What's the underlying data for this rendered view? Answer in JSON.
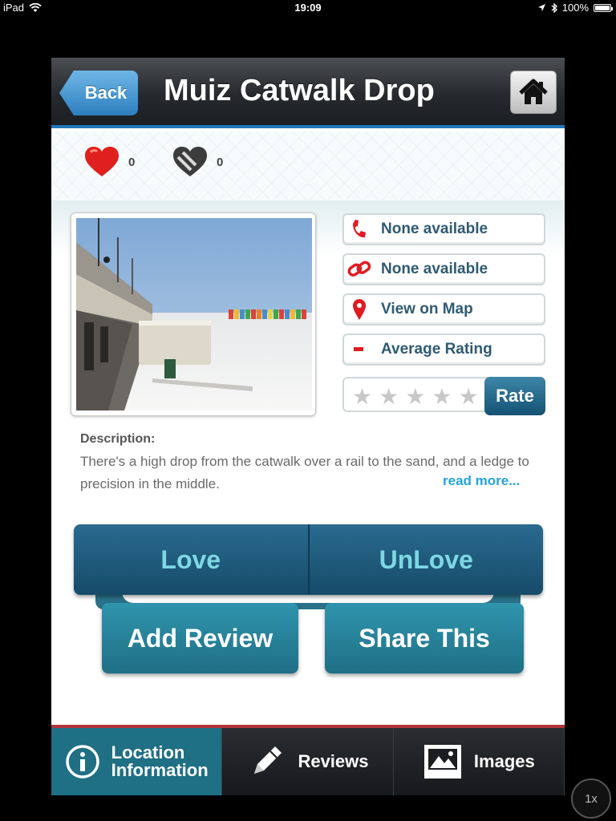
{
  "status_bar": {
    "device": "iPad",
    "time": "19:09",
    "battery": "100%"
  },
  "nav": {
    "back_label": "Back",
    "title": "Muiz Catwalk Drop"
  },
  "counters": {
    "love_count": "0",
    "unlove_count": "0"
  },
  "info_buttons": [
    {
      "label": "None available",
      "icon": "phone-icon"
    },
    {
      "label": "None available",
      "icon": "link-icon"
    },
    {
      "label": "View on Map",
      "icon": "map-pin-icon"
    },
    {
      "label": "Average Rating",
      "icon": "rating-indicator-icon"
    }
  ],
  "rating": {
    "stars_filled": 0,
    "stars_total": 5,
    "rate_label": "Rate"
  },
  "description": {
    "title": "Description:",
    "text": "There's a high drop from the catwalk over a rail to the sand, and a ledge to precision in the middle.",
    "read_more": "read more..."
  },
  "actions": {
    "love": "Love",
    "unlove": "UnLove",
    "add_review": "Add Review",
    "share": "Share This"
  },
  "tabs": [
    {
      "label": "Location Information",
      "line1": "Location",
      "line2": "Information",
      "icon": "info-icon",
      "active": true
    },
    {
      "label": "Reviews",
      "icon": "pencil-icon",
      "active": false
    },
    {
      "label": "Images",
      "icon": "images-icon",
      "active": false
    }
  ],
  "zoom_badge": "1x",
  "colors": {
    "nav_accent": "#1f78b9",
    "tab_accent": "#b1343a",
    "button_teal": "#1f6f85",
    "love_text": "#7ed7e3",
    "link_blue": "#27a3d8"
  }
}
